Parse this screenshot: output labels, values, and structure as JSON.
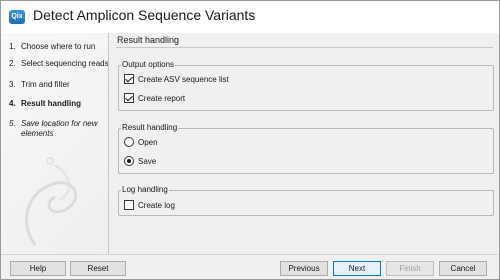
{
  "window": {
    "title": "Detect Amplicon Sequence Variants",
    "app_icon_text": "Qix"
  },
  "sidebar": {
    "steps": [
      {
        "number": "1.",
        "label": "Choose where to run",
        "state": "done"
      },
      {
        "number": "2.",
        "label": "Select sequencing reads",
        "state": "done"
      },
      {
        "number": "3.",
        "label": "Trim and filter",
        "state": "done"
      },
      {
        "number": "4.",
        "label": "Result handling",
        "state": "current"
      },
      {
        "number": "5.",
        "label": "Save location for new elements",
        "state": "future"
      }
    ]
  },
  "content": {
    "heading": "Result handling",
    "output_options": {
      "label": "Output options",
      "create_asv_list": {
        "label": "Create ASV sequence list",
        "checked": true
      },
      "create_report": {
        "label": "Create report",
        "checked": true
      }
    },
    "result_handling": {
      "label": "Result handling",
      "open": {
        "label": "Open",
        "selected": false
      },
      "save": {
        "label": "Save",
        "selected": true
      }
    },
    "log_handling": {
      "label": "Log handling",
      "create_log": {
        "label": "Create log",
        "checked": false
      }
    }
  },
  "footer": {
    "help": "Help",
    "reset": "Reset",
    "previous": "Previous",
    "next": "Next",
    "finish": "Finish",
    "cancel": "Cancel"
  }
}
